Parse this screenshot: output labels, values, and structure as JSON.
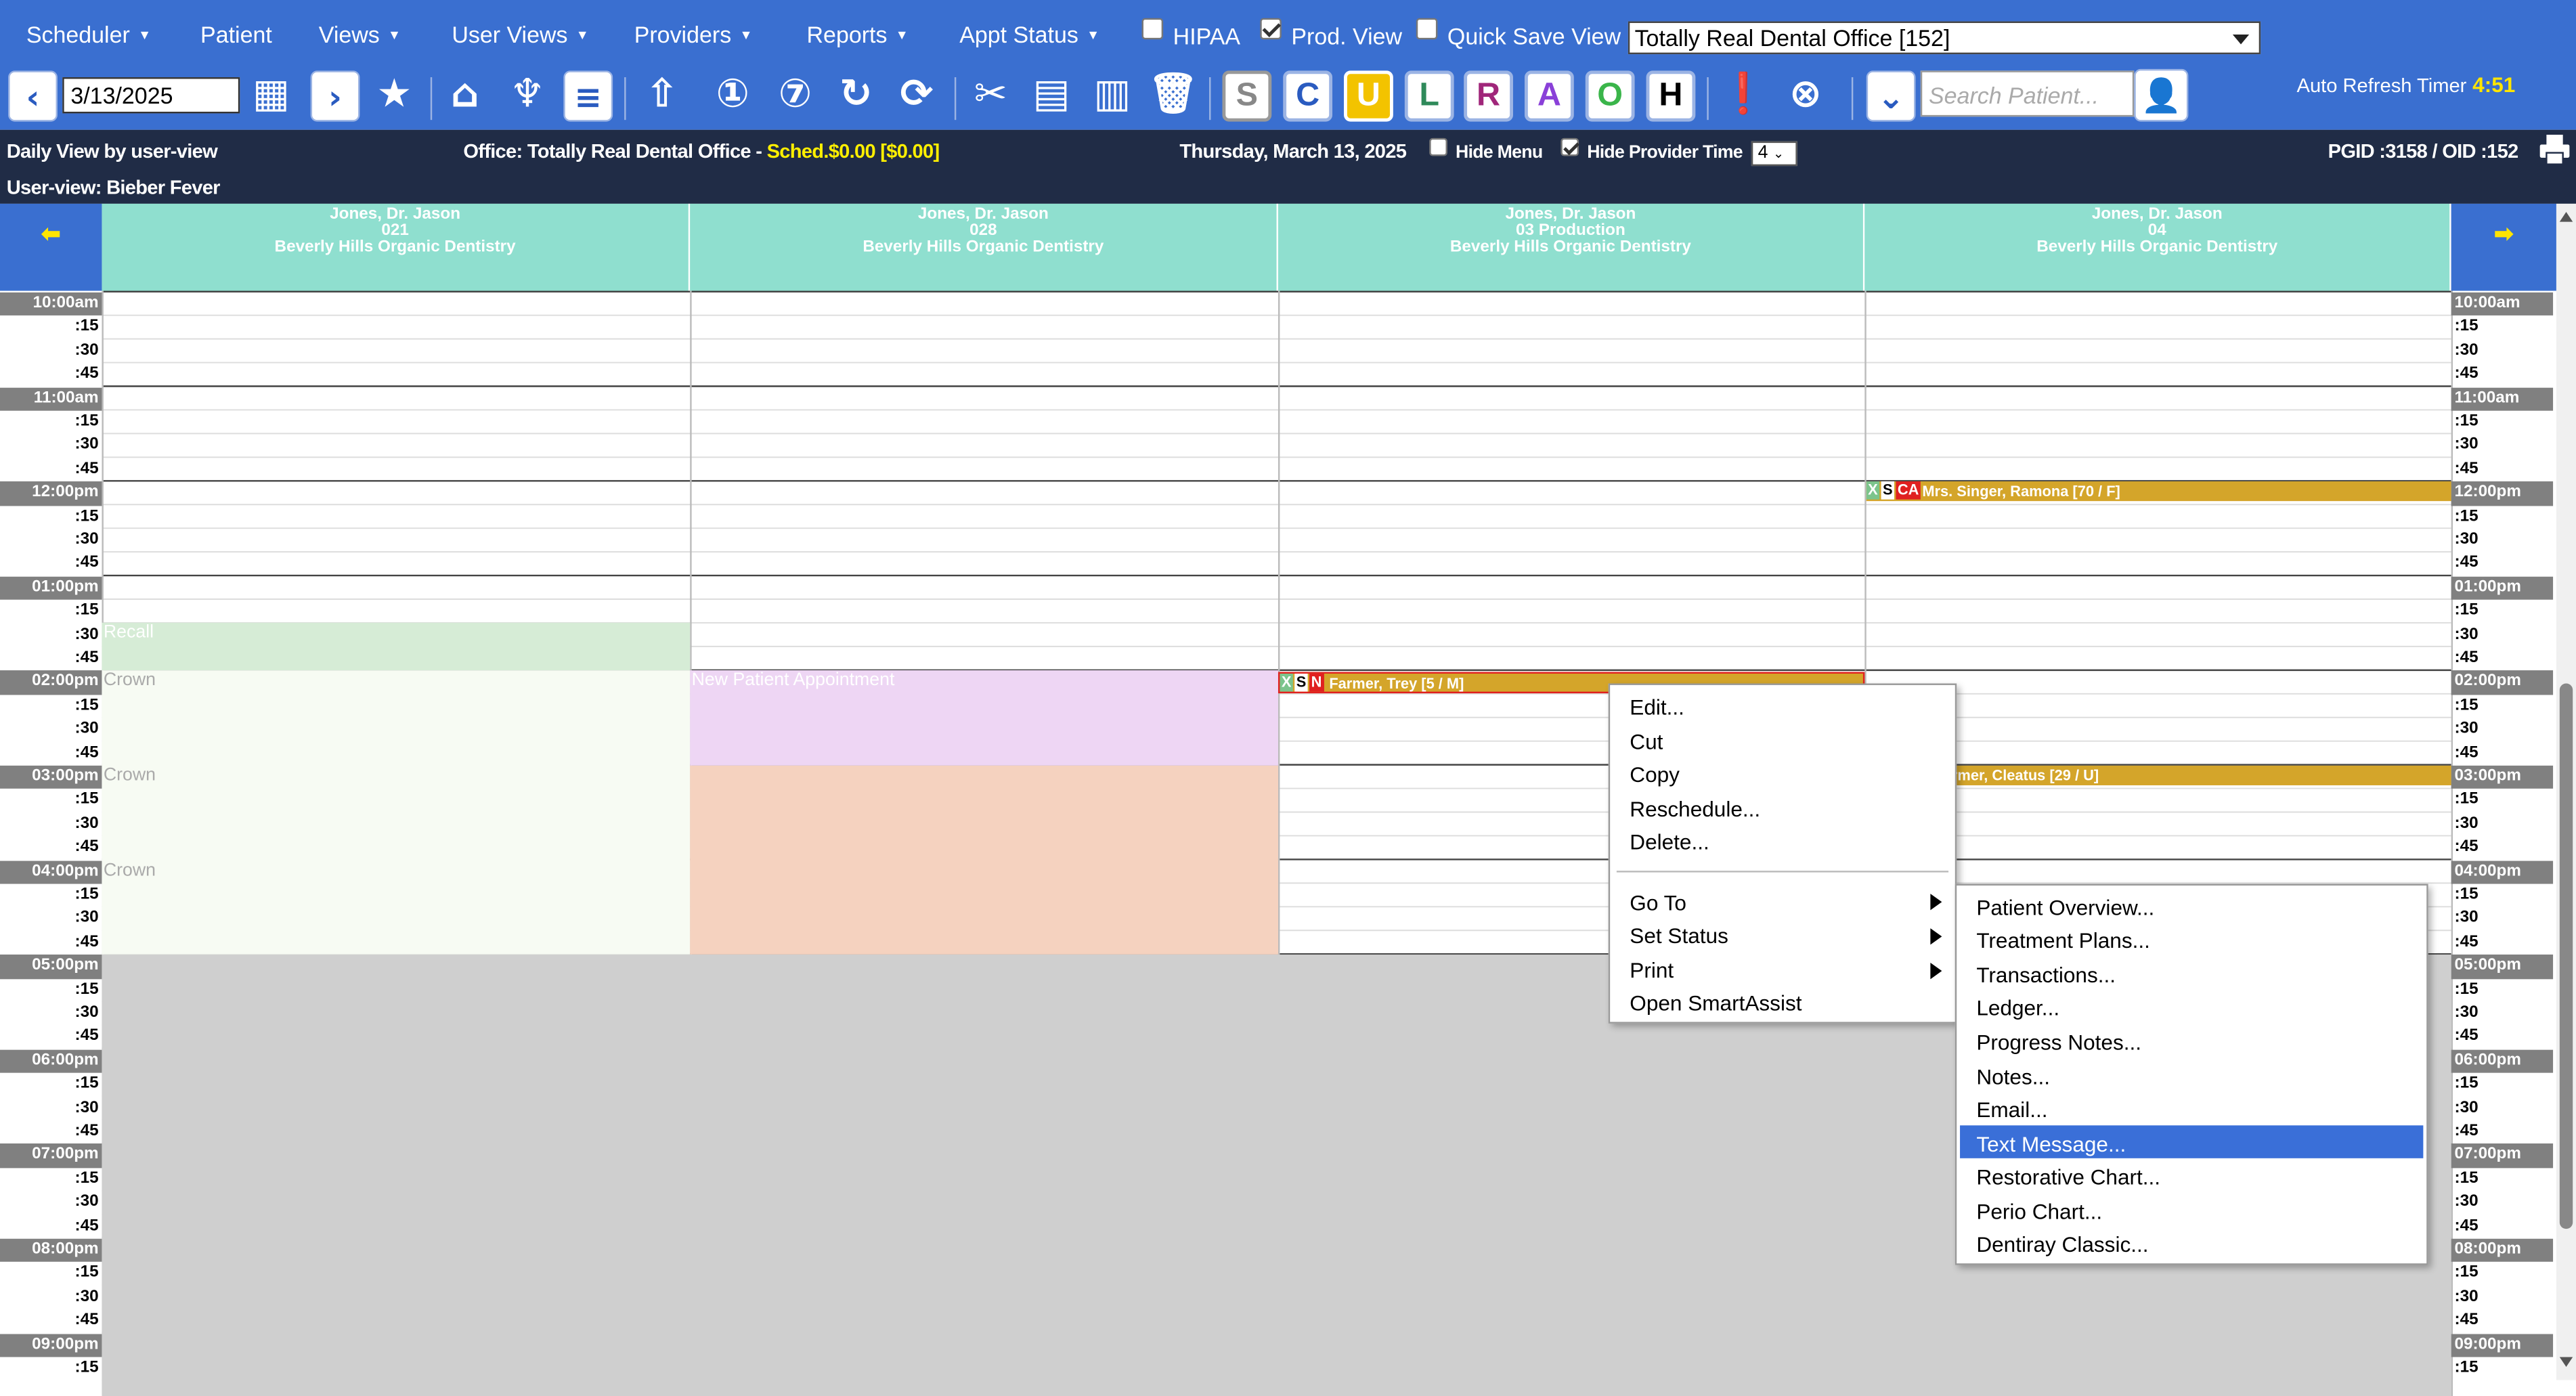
{
  "menu": {
    "items": [
      "Scheduler",
      "Patient",
      "Views",
      "User Views",
      "Providers",
      "Reports",
      "Appt Status"
    ],
    "hipaa": "HIPAA",
    "prod_view": "Prod. View",
    "quick_save": "Quick Save View",
    "office_select": "Totally Real Dental Office [152]"
  },
  "toolbar": {
    "date": "3/13/2025",
    "search_placeholder": "Search Patient...",
    "letters": [
      "S",
      "C",
      "U",
      "L",
      "R",
      "A",
      "O",
      "H"
    ],
    "auto_refresh_label": "Auto Refresh Timer",
    "auto_refresh_value": "4:51"
  },
  "info": {
    "view_label": "Daily View by user-view",
    "office_label": "Office: Totally Real Dental Office - ",
    "sched": "Sched.$0.00 [$0.00]",
    "date_long": "Thursday, March 13, 2025",
    "hide_menu": "Hide Menu",
    "hide_provider_time": "Hide Provider Time",
    "columns_count": "4",
    "ids": "PGID :3158  /  OID :152",
    "user_view": "User-view: Bieber Fever"
  },
  "nav": {
    "prev": "⬅",
    "next": "➡"
  },
  "columns": [
    {
      "provider": "Jones, Dr. Jason",
      "op": "021",
      "practice": "Beverly Hills Organic Dentistry"
    },
    {
      "provider": "Jones, Dr. Jason",
      "op": "028",
      "practice": "Beverly Hills Organic Dentistry"
    },
    {
      "provider": "Jones, Dr. Jason",
      "op": "03 Production",
      "practice": "Beverly Hills Organic Dentistry"
    },
    {
      "provider": "Jones, Dr. Jason",
      "op": "04",
      "practice": "Beverly Hills Organic Dentistry"
    }
  ],
  "times": [
    "10:00am",
    ":15",
    ":30",
    ":45",
    "11:00am",
    ":15",
    ":30",
    ":45",
    "12:00pm",
    ":15",
    ":30",
    ":45",
    "01:00pm",
    ":15",
    ":30",
    ":45",
    "02:00pm",
    ":15",
    ":30",
    ":45",
    "03:00pm",
    ":15",
    ":30",
    ":45",
    "04:00pm",
    ":15",
    ":30",
    ":45",
    "05:00pm",
    ":15",
    ":30",
    ":45",
    "06:00pm",
    ":15",
    ":30",
    ":45",
    "07:00pm",
    ":15",
    ":30",
    ":45",
    "08:00pm",
    ":15",
    ":30",
    ":45",
    "09:00pm",
    ":15"
  ],
  "blocks": {
    "recall": "Recall",
    "crown": "Crown",
    "new_patient": "New Patient Appointment"
  },
  "appointments": {
    "singer": {
      "icons": [
        "X",
        "S",
        "CA"
      ],
      "name": "Mrs. Singer, Ramona [70 / F]"
    },
    "farmer_trey": {
      "icons": [
        "X",
        "S",
        "N"
      ],
      "name": "Farmer, Trey [5 / M]"
    },
    "farmer_cleatus": {
      "name": "rmer, Cleatus [29 / U]"
    }
  },
  "context_menu": {
    "items": [
      "Edit...",
      "Cut",
      "Copy",
      "Reschedule...",
      "Delete..."
    ],
    "items2": [
      "Go To",
      "Set Status",
      "Print",
      "Open SmartAssist"
    ]
  },
  "submenu": {
    "items": [
      "Patient Overview...",
      "Treatment Plans...",
      "Transactions...",
      "Ledger...",
      "Progress Notes...",
      "Notes...",
      "Email...",
      "Text Message...",
      "Restorative Chart...",
      "Perio Chart...",
      "Dentiray Classic..."
    ],
    "highlighted": "Text Message..."
  },
  "colors": {
    "accent": "#3a6fd0",
    "header": "#8fdfcf",
    "appt_gold": "#d4a52a",
    "highlight": "#3a6fd8"
  }
}
